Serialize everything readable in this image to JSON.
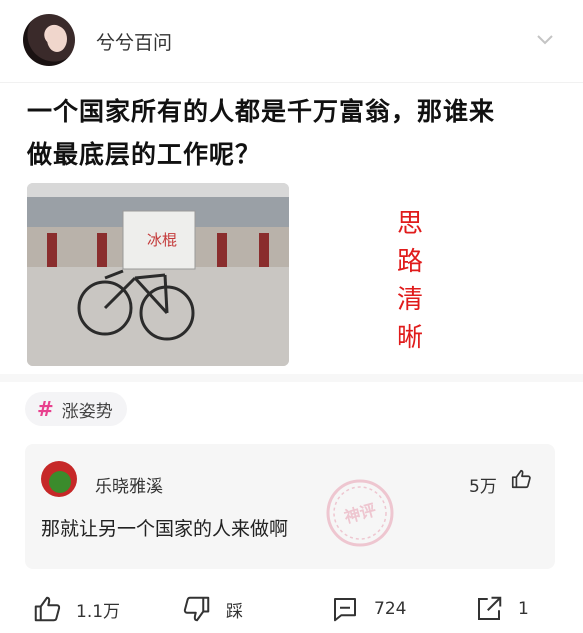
{
  "header": {
    "author_name": "兮兮百问",
    "avatar_icon": "user-avatar",
    "menu_icon": "chevron-down-icon"
  },
  "post": {
    "title_line1": "一个国家所有的人都是千万富翁，那谁来",
    "title_line2": "做最底层的工作呢？",
    "image_caption": "冰棍",
    "side_chars": [
      "思",
      "路",
      "清",
      "晰"
    ],
    "side_color": "#e01b1b"
  },
  "tag": {
    "icon": "#",
    "label": "涨姿势",
    "icon_color": "#e8408e"
  },
  "comment": {
    "author": "乐晓雅溪",
    "like_count": "5万",
    "text": "那就让另一个国家的人来做啊",
    "stamp_text": "神评",
    "stamp_color": "#e8a0b2"
  },
  "actions": {
    "like_label": "1.1万",
    "dislike_label": "踩",
    "comment_label": "724",
    "share_label": "1"
  }
}
